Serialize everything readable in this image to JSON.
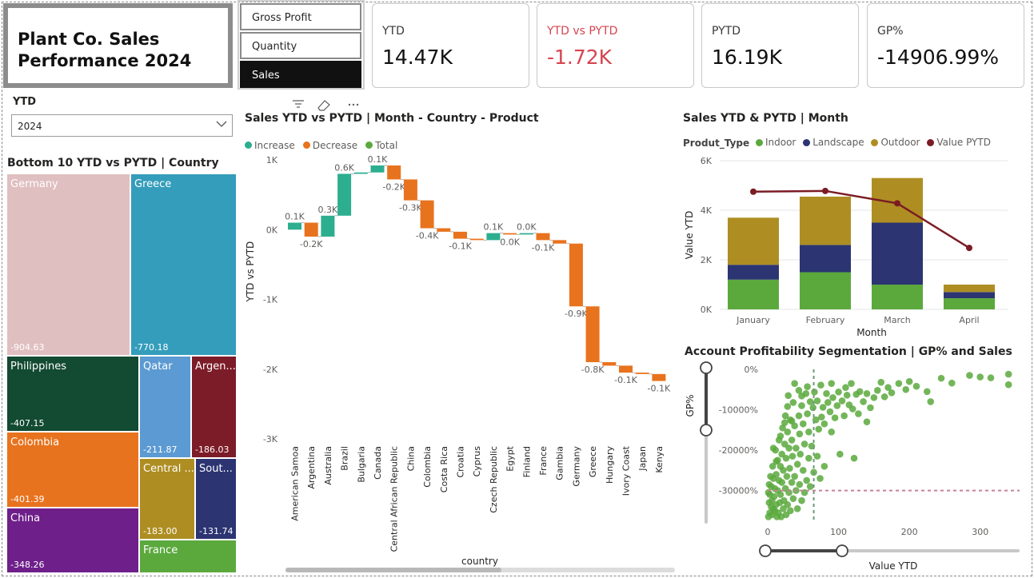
{
  "header": {
    "title_line1": "Plant Co. Sales",
    "title_line2": "Performance 2024"
  },
  "metric_slicer": {
    "items": [
      "Gross Profit",
      "Quantity",
      "Sales"
    ],
    "selected": "Sales"
  },
  "cards": [
    {
      "label": "YTD",
      "value": "14.47K"
    },
    {
      "label": "YTD vs PYTD",
      "value": "-1.72K"
    },
    {
      "label": "PYTD",
      "value": "16.19K"
    },
    {
      "label": "GP%",
      "value": "-14906.99%"
    }
  ],
  "year_slicer": {
    "label": "YTD",
    "value": "2024"
  },
  "colors": {
    "increase": "#2cae8f",
    "decrease": "#e8731e",
    "total": "#5ba93d",
    "negative_card": "#d64550",
    "indoor": "#5ba93d",
    "landscape": "#2c3572",
    "outdoor": "#ae8e22",
    "pytd_line": "#7b1c24"
  },
  "chart_data": [
    {
      "type": "treemap",
      "title": "Bottom 10 YTD vs PYTD | Country",
      "items": [
        {
          "name": "Germany",
          "value": "-904.63",
          "color": "#e0bfc1"
        },
        {
          "name": "Greece",
          "value": "-770.18",
          "color": "#349dbb"
        },
        {
          "name": "Philippines",
          "value": "-407.15",
          "color": "#134a32"
        },
        {
          "name": "Colombia",
          "value": "-401.39",
          "color": "#e8731e"
        },
        {
          "name": "China",
          "value": "-348.26",
          "color": "#6e1f8a"
        },
        {
          "name": "Qatar",
          "value": "-211.87",
          "color": "#5b9ad3"
        },
        {
          "name": "Argen...",
          "value": "-186.03",
          "color": "#7c1c28"
        },
        {
          "name": "Central ...",
          "value": "-183.00",
          "color": "#ae8e22"
        },
        {
          "name": "Sout...",
          "value": "-131.74",
          "color": "#2c3572"
        },
        {
          "name": "France",
          "value": "",
          "color": "#5ba93d"
        }
      ]
    },
    {
      "type": "waterfall",
      "title": "Sales YTD vs PYTD | Month - Country - Product",
      "legend": [
        "Increase",
        "Decrease",
        "Total"
      ],
      "ylabel": "YTD vs PYTD",
      "xlabel": "country",
      "yticks": [
        "1K",
        "0K",
        "-1K",
        "-2K",
        "-3K"
      ],
      "ylim": [
        -3,
        1
      ],
      "categories": [
        "American Samoa",
        "Argentina",
        "Australia",
        "Brazil",
        "Bulgaria",
        "Canada",
        "Central African Republic",
        "China",
        "Colombia",
        "Costa Rica",
        "Croatia",
        "Cyprus",
        "Czech Republic",
        "Egypt",
        "Finland",
        "France",
        "Gambia",
        "Germany",
        "Greece",
        "Hungary",
        "Ivory Coast",
        "Japan",
        "Kenya"
      ],
      "bars": [
        {
          "delta": 0.1,
          "label": "0.1K"
        },
        {
          "delta": -0.2,
          "label": "-0.2K"
        },
        {
          "delta": 0.3,
          "label": "0.3K"
        },
        {
          "delta": 0.6,
          "label": "0.6K"
        },
        {
          "delta": 0.02,
          "label": ""
        },
        {
          "delta": 0.1,
          "label": "0.1K"
        },
        {
          "delta": -0.2,
          "label": "-0.2K"
        },
        {
          "delta": -0.3,
          "label": "-0.3K"
        },
        {
          "delta": -0.4,
          "label": "-0.4K"
        },
        {
          "delta": -0.05,
          "label": ""
        },
        {
          "delta": -0.1,
          "label": "-0.1K"
        },
        {
          "delta": -0.02,
          "label": ""
        },
        {
          "delta": 0.1,
          "label": "0.1K"
        },
        {
          "delta": -0.02,
          "label": "0.0K"
        },
        {
          "delta": 0.02,
          "label": "0.0K"
        },
        {
          "delta": -0.1,
          "label": "-0.1K"
        },
        {
          "delta": -0.05,
          "label": ""
        },
        {
          "delta": -0.9,
          "label": "-0.9K"
        },
        {
          "delta": -0.8,
          "label": "-0.8K"
        },
        {
          "delta": -0.05,
          "label": ""
        },
        {
          "delta": -0.1,
          "label": "-0.1K"
        },
        {
          "delta": -0.02,
          "label": ""
        },
        {
          "delta": -0.1,
          "label": "-0.1K"
        }
      ]
    },
    {
      "type": "bar",
      "stacked": true,
      "title": "Sales YTD & PYTD | Month",
      "legend_title": "Produt_Type",
      "xlabel": "Month",
      "ylabel": "Value YTD",
      "categories": [
        "January",
        "February",
        "March",
        "April"
      ],
      "yticks": [
        "6K",
        "4K",
        "2K",
        "0K"
      ],
      "ylim": [
        0,
        6
      ],
      "series": [
        {
          "name": "Indoor",
          "values": [
            1.2,
            1.5,
            1.0,
            0.45
          ]
        },
        {
          "name": "Landscape",
          "values": [
            0.6,
            1.1,
            2.5,
            0.25
          ]
        },
        {
          "name": "Outdoor",
          "values": [
            1.9,
            1.95,
            1.8,
            0.3
          ]
        }
      ],
      "line": {
        "name": "Value PYTD",
        "values": [
          4.75,
          4.78,
          4.28,
          2.48
        ]
      }
    },
    {
      "type": "scatter",
      "title": "Account Profitability Segmentation | GP% and Sales",
      "xlabel": "Value YTD",
      "ylabel": "GP%",
      "xticks": [
        "0",
        "100",
        "200",
        "300"
      ],
      "yticks": [
        "0%",
        "-10000%",
        "-20000%",
        "-30000%"
      ],
      "xlim": [
        0,
        350
      ],
      "ylim": [
        -38000,
        0
      ],
      "reference": {
        "x": 65,
        "y": -30000
      },
      "points": [
        [
          340,
          -1200
        ],
        [
          340,
          -3800
        ],
        [
          315,
          -2100
        ],
        [
          300,
          -1900
        ],
        [
          285,
          -1500
        ],
        [
          260,
          -3400
        ],
        [
          245,
          -2200
        ],
        [
          230,
          -8000
        ],
        [
          225,
          -5500
        ],
        [
          210,
          -4200
        ],
        [
          200,
          -3000
        ],
        [
          195,
          -5000
        ],
        [
          185,
          -3500
        ],
        [
          175,
          -5800
        ],
        [
          170,
          -4500
        ],
        [
          165,
          -6800
        ],
        [
          160,
          -3200
        ],
        [
          155,
          -5200
        ],
        [
          150,
          -7000
        ],
        [
          145,
          -9500
        ],
        [
          140,
          -6000
        ],
        [
          140,
          -13000
        ],
        [
          135,
          -8000
        ],
        [
          130,
          -5500
        ],
        [
          128,
          -11000
        ],
        [
          125,
          -6200
        ],
        [
          122,
          -22000
        ],
        [
          120,
          -9800
        ],
        [
          118,
          -3500
        ],
        [
          115,
          -8800
        ],
        [
          112,
          -6400
        ],
        [
          110,
          -4500
        ],
        [
          108,
          -11500
        ],
        [
          105,
          -7800
        ],
        [
          102,
          -21000
        ],
        [
          100,
          -5600
        ],
        [
          98,
          -9000
        ],
        [
          95,
          -12000
        ],
        [
          92,
          -7000
        ],
        [
          90,
          -3500
        ],
        [
          90,
          -15500
        ],
        [
          88,
          -10500
        ],
        [
          85,
          -8200
        ],
        [
          83,
          -6000
        ],
        [
          80,
          -13500
        ],
        [
          80,
          -24000
        ],
        [
          78,
          -9400
        ],
        [
          76,
          -11800
        ],
        [
          75,
          -3900
        ],
        [
          74,
          -27000
        ],
        [
          72,
          -14800
        ],
        [
          70,
          -7800
        ],
        [
          70,
          -21500
        ],
        [
          68,
          -12500
        ],
        [
          66,
          -5600
        ],
        [
          65,
          -25500
        ],
        [
          64,
          -9500
        ],
        [
          62,
          -19000
        ],
        [
          60,
          -8000
        ],
        [
          60,
          -29000
        ],
        [
          58,
          -15500
        ],
        [
          58,
          -22000
        ],
        [
          56,
          -11000
        ],
        [
          55,
          -27500
        ],
        [
          54,
          -6000
        ],
        [
          52,
          -30500
        ],
        [
          52,
          -18500
        ],
        [
          50,
          -13500
        ],
        [
          50,
          -25000
        ],
        [
          48,
          -9000
        ],
        [
          48,
          -32500
        ],
        [
          46,
          -21000
        ],
        [
          45,
          -16000
        ],
        [
          45,
          -28500
        ],
        [
          44,
          -11500
        ],
        [
          42,
          -34500
        ],
        [
          42,
          -23500
        ],
        [
          40,
          -19500
        ],
        [
          40,
          -30000
        ],
        [
          38,
          -14000
        ],
        [
          38,
          -26500
        ],
        [
          36,
          -8200
        ],
        [
          36,
          -32000
        ],
        [
          35,
          -21500
        ],
        [
          34,
          -17500
        ],
        [
          34,
          -28000
        ],
        [
          32,
          -12500
        ],
        [
          32,
          -35000
        ],
        [
          31,
          -24500
        ],
        [
          30,
          -30500
        ],
        [
          30,
          -19500
        ],
        [
          29,
          -6500
        ],
        [
          28,
          -33500
        ],
        [
          28,
          -15500
        ],
        [
          27,
          -26500
        ],
        [
          26,
          -22000
        ],
        [
          26,
          -36000
        ],
        [
          25,
          -29500
        ],
        [
          25,
          -11500
        ],
        [
          24,
          -18500
        ],
        [
          23,
          -32500
        ],
        [
          22,
          -25000
        ],
        [
          22,
          -34500
        ],
        [
          21,
          -14500
        ],
        [
          20,
          -28000
        ],
        [
          20,
          -21000
        ],
        [
          19,
          -36500
        ],
        [
          18,
          -31000
        ],
        [
          18,
          -24000
        ],
        [
          17,
          -33000
        ],
        [
          16,
          -27500
        ],
        [
          16,
          -17500
        ],
        [
          15,
          -35500
        ],
        [
          14,
          -30000
        ],
        [
          14,
          -22500
        ],
        [
          13,
          -36500
        ],
        [
          12,
          -26000
        ],
        [
          12,
          -33500
        ],
        [
          11,
          -20000
        ],
        [
          10,
          -29500
        ],
        [
          10,
          -35000
        ],
        [
          9,
          -31500
        ],
        [
          8,
          -27000
        ],
        [
          8,
          -34500
        ],
        [
          7,
          -24000
        ],
        [
          6,
          -32500
        ],
        [
          6,
          -36000
        ],
        [
          5,
          -29000
        ],
        [
          5,
          -34000
        ],
        [
          4,
          -26500
        ],
        [
          3,
          -31000
        ],
        [
          3,
          -35500
        ],
        [
          2,
          -28500
        ],
        [
          2,
          -33000
        ],
        [
          1,
          -36500
        ],
        [
          1,
          -30500
        ],
        [
          38,
          -3500
        ],
        [
          28,
          -9200
        ],
        [
          44,
          -5200
        ],
        [
          34,
          -12800
        ],
        [
          56,
          -4300
        ],
        [
          48,
          -6600
        ],
        [
          18,
          -16500
        ],
        [
          24,
          -13200
        ],
        [
          12,
          -22800
        ],
        [
          8,
          -19500
        ]
      ]
    }
  ]
}
